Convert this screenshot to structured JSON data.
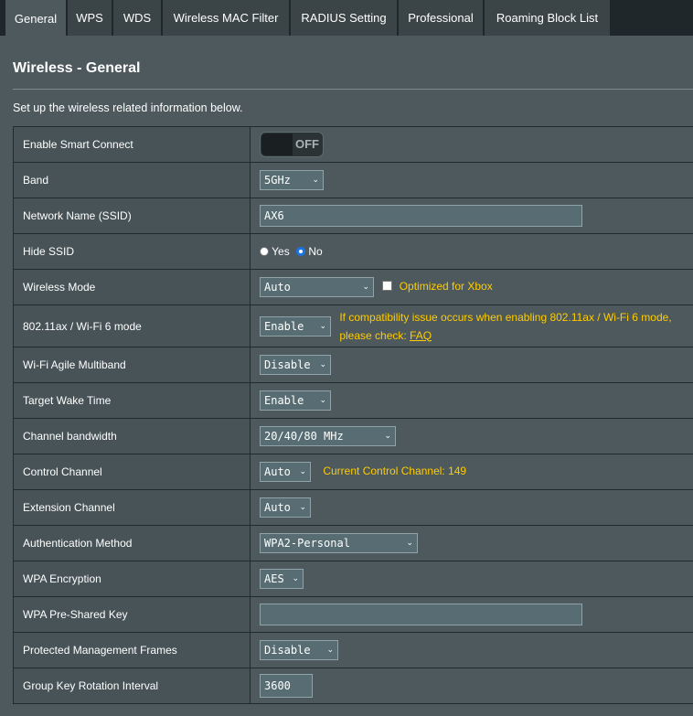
{
  "tabs": [
    "General",
    "WPS",
    "WDS",
    "Wireless MAC Filter",
    "RADIUS Setting",
    "Professional",
    "Roaming Block List"
  ],
  "title": "Wireless - General",
  "description": "Set up the wireless related information below.",
  "rows": {
    "smart_connect": {
      "label": "Enable Smart Connect",
      "toggle": "OFF"
    },
    "band": {
      "label": "Band",
      "value": "5GHz"
    },
    "ssid": {
      "label": "Network Name (SSID)",
      "value": "AX6"
    },
    "hide_ssid": {
      "label": "Hide SSID",
      "yes": "Yes",
      "no": "No",
      "selected": "No"
    },
    "wireless_mode": {
      "label": "Wireless Mode",
      "value": "Auto",
      "xbox_label": "Optimized for Xbox"
    },
    "wifi6_mode": {
      "label": "802.11ax / Wi-Fi 6 mode",
      "value": "Enable",
      "note": "If compatibility issue occurs when enabling 802.11ax / Wi-Fi 6 mode,",
      "note2": "please check:",
      "faq": "FAQ"
    },
    "agile_multiband": {
      "label": "Wi-Fi Agile Multiband",
      "value": "Disable"
    },
    "target_wake": {
      "label": "Target Wake Time",
      "value": "Enable"
    },
    "channel_bandwidth": {
      "label": "Channel bandwidth",
      "value": "20/40/80 MHz"
    },
    "control_channel": {
      "label": "Control Channel",
      "value": "Auto",
      "note": "Current Control Channel: 149"
    },
    "extension_channel": {
      "label": "Extension Channel",
      "value": "Auto"
    },
    "auth_method": {
      "label": "Authentication Method",
      "value": "WPA2-Personal"
    },
    "wpa_encryption": {
      "label": "WPA Encryption",
      "value": "AES"
    },
    "wpa_psk": {
      "label": "WPA Pre-Shared Key",
      "value": ""
    },
    "pmf": {
      "label": "Protected Management Frames",
      "value": "Disable"
    },
    "gk_rotation": {
      "label": "Group Key Rotation Interval",
      "value": "3600"
    }
  },
  "colors": {
    "accent": "#ffcc00",
    "panel": "#4d595d",
    "label_bg": "#475357",
    "tab_bar": "#20272a"
  }
}
